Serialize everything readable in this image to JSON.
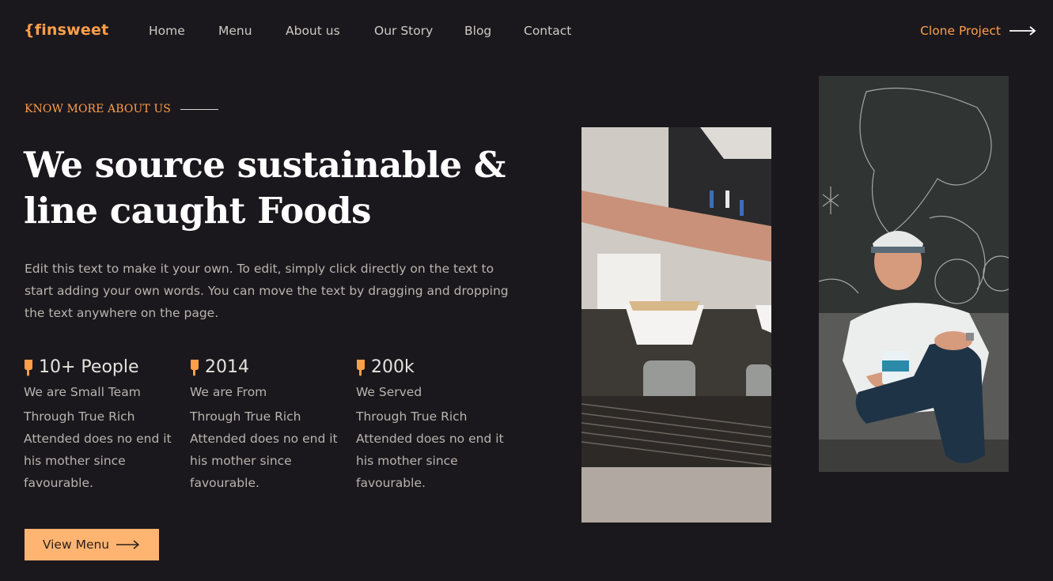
{
  "nav": {
    "logo": "{finsweet",
    "links": [
      "Home",
      "Menu",
      "About us",
      "Our Story",
      "Blog",
      "Contact"
    ],
    "cta": "Clone Project"
  },
  "hero": {
    "eyebrow": "KNOW MORE ABOUT US",
    "headline_line1": "We source sustainable &",
    "headline_line2": "line caught Foods",
    "intro": "Edit this text to make it your own. To edit, simply click directly on the text to start adding your own words. You can move the text by dragging and dropping the text anywhere on the page.",
    "stats": [
      {
        "value": "10+ People",
        "label": "We are Small Team",
        "desc": "Through True Rich Attended does no end it his mother since favourable."
      },
      {
        "value": "2014",
        "label": "We are From",
        "desc": "Through True Rich Attended does no end it his mother since favourable."
      },
      {
        "value": "200k",
        "label": "We Served",
        "desc": "Through True Rich Attended does no end it his mother since favourable."
      }
    ],
    "button": "View Menu"
  },
  "colors": {
    "background": "#1b181d",
    "accent": "#ff9f4a",
    "button": "#ffb472"
  },
  "icons": {
    "stat_icon": "ice-cream-icon",
    "arrow": "arrow-right-icon"
  }
}
